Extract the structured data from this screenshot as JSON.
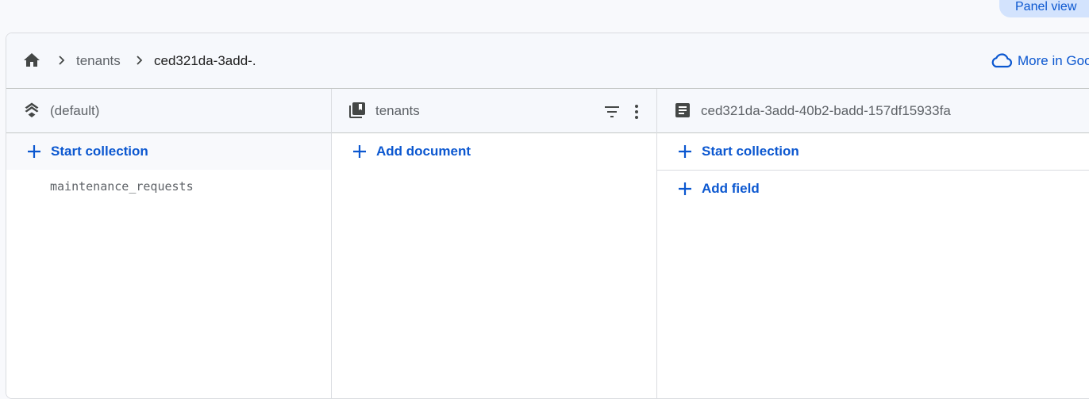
{
  "top": {
    "panel_view_label": "Panel view"
  },
  "breadcrumb": {
    "home_icon": "home-icon",
    "items": [
      "tenants",
      "ced321da-3add-."
    ],
    "more_link": "More in Goo"
  },
  "columns": {
    "database": {
      "icon": "database-stack-icon",
      "title": "(default)",
      "action": "Start collection",
      "items": [
        "maintenance_requests"
      ]
    },
    "collection": {
      "icon": "collection-icon",
      "title": "tenants",
      "action": "Add document"
    },
    "document": {
      "icon": "document-icon",
      "title": "ced321da-3add-40b2-badd-157df15933fa",
      "actions": [
        "Start collection",
        "Add field"
      ]
    }
  },
  "colors": {
    "accent": "#0b57d0",
    "header_bg": "#f6f8fc",
    "icon": "#444746"
  }
}
